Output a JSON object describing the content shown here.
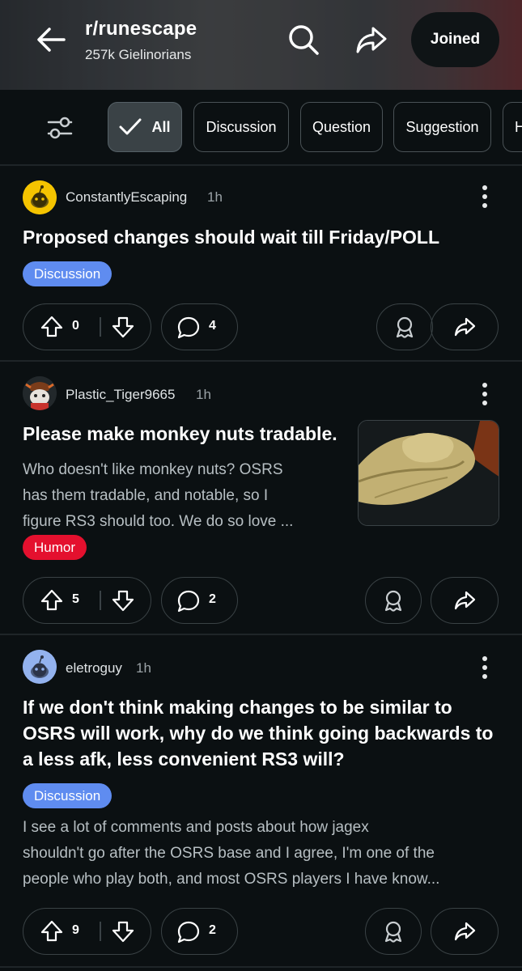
{
  "header": {
    "subreddit": "r/runescape",
    "members": "257k Gielinorians",
    "joined_label": "Joined"
  },
  "filters": {
    "chips": [
      "All",
      "Discussion",
      "Question",
      "Suggestion",
      "H"
    ],
    "active": "All"
  },
  "posts": [
    {
      "author": "ConstantlyEscaping",
      "time": "1h",
      "title": "Proposed changes should wait till Friday/POLL",
      "flair": "Discussion",
      "votes": "0",
      "comments": "4"
    },
    {
      "author": "Plastic_Tiger9665",
      "time": "1h",
      "title": "Please make monkey nuts tradable.",
      "body_lines": [
        "Who doesn't like monkey nuts? OSRS",
        "has them tradable, and notable, so I",
        "figure RS3 should too. We do so love ..."
      ],
      "flair": "Humor",
      "votes": "5",
      "comments": "2"
    },
    {
      "author": "eletroguy",
      "time": "1h",
      "title_lines": [
        "If we don't think making changes to be similar to",
        "OSRS will work, why do we think going backwards to",
        "a less afk, less convenient RS3 will?"
      ],
      "flair": "Discussion",
      "body_lines": [
        "I see a lot of comments and posts about how jagex",
        "shouldn't go after the OSRS base and I agree, I'm one of the",
        "people who play both, and most OSRS players I have know..."
      ],
      "votes": "9",
      "comments": "2"
    }
  ],
  "colors": {
    "background": "#0b1012",
    "flair_discussion": "#5f8cf0",
    "flair_humor": "#e4102e",
    "border": "#3a4245"
  },
  "icons": [
    "back-arrow-icon",
    "search-icon",
    "share-icon",
    "filter-sliders-icon",
    "checkmark-icon",
    "upvote-icon",
    "downvote-icon",
    "comment-icon",
    "award-icon",
    "more-options-icon"
  ]
}
